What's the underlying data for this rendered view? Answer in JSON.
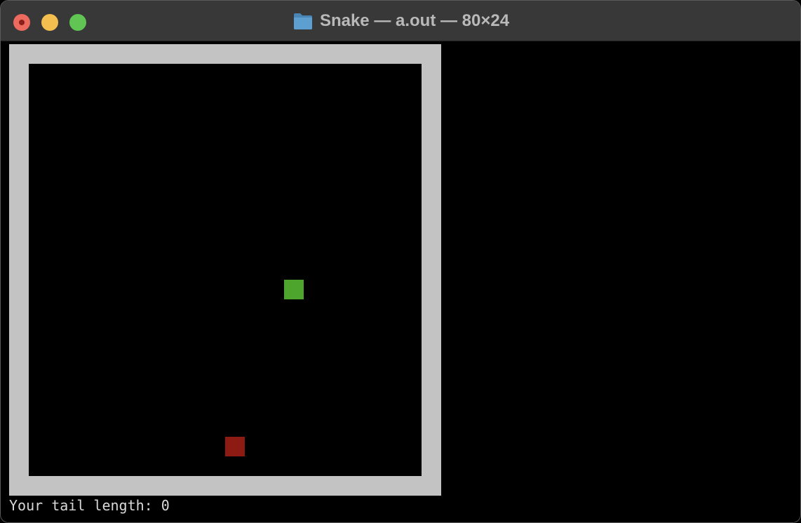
{
  "window": {
    "title": "Snake — a.out — 80×24",
    "folder_icon": "folder-icon"
  },
  "traffic_lights": {
    "close_color": "#ec6a5e",
    "minimize_color": "#f4bf4f",
    "zoom_color": "#61c554"
  },
  "game": {
    "border_color": "#c3c3c3",
    "snake_head_color": "#4ea52d",
    "food_color": "#8e1a14"
  },
  "status": {
    "text": "Your tail length: 0"
  }
}
